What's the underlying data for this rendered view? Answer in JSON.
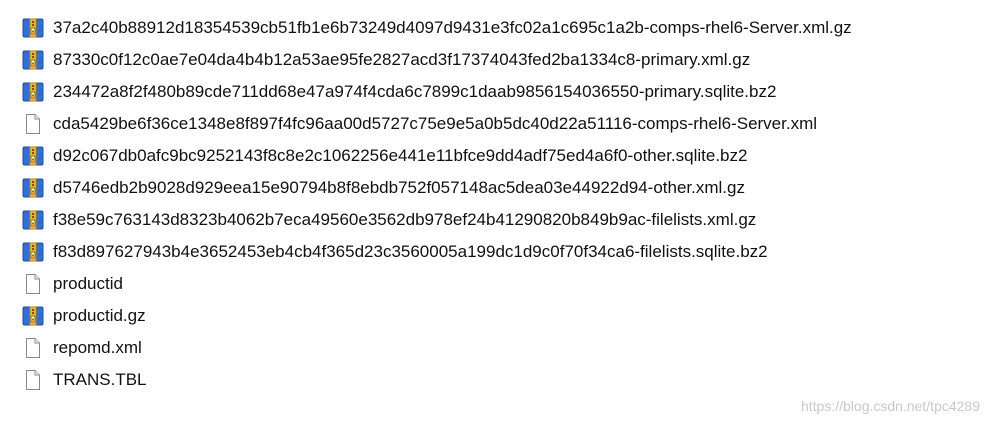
{
  "files": [
    {
      "name": "37a2c40b88912d18354539cb51fb1e6b73249d4097d9431e3fc02a1c695c1a2b-comps-rhel6-Server.xml.gz",
      "icon": "archive-icon"
    },
    {
      "name": "87330c0f12c0ae7e04da4b4b12a53ae95fe2827acd3f17374043fed2ba1334c8-primary.xml.gz",
      "icon": "archive-icon"
    },
    {
      "name": "234472a8f2f480b89cde711dd68e47a974f4cda6c7899c1daab9856154036550-primary.sqlite.bz2",
      "icon": "archive-icon"
    },
    {
      "name": "cda5429be6f36ce1348e8f897f4fc96aa00d5727c75e9e5a0b5dc40d22a51116-comps-rhel6-Server.xml",
      "icon": "document-icon"
    },
    {
      "name": "d92c067db0afc9bc9252143f8c8e2c1062256e441e11bfce9dd4adf75ed4a6f0-other.sqlite.bz2",
      "icon": "archive-icon"
    },
    {
      "name": "d5746edb2b9028d929eea15e90794b8f8ebdb752f057148ac5dea03e44922d94-other.xml.gz",
      "icon": "archive-icon"
    },
    {
      "name": "f38e59c763143d8323b4062b7eca49560e3562db978ef24b41290820b849b9ac-filelists.xml.gz",
      "icon": "archive-icon"
    },
    {
      "name": "f83d897627943b4e3652453eb4cb4f365d23c3560005a199dc1d9c0f70f34ca6-filelists.sqlite.bz2",
      "icon": "archive-icon"
    },
    {
      "name": "productid",
      "icon": "document-icon"
    },
    {
      "name": "productid.gz",
      "icon": "archive-icon"
    },
    {
      "name": "repomd.xml",
      "icon": "document-icon"
    },
    {
      "name": "TRANS.TBL",
      "icon": "document-icon"
    }
  ],
  "watermark": "https://blog.csdn.net/tpc4289"
}
